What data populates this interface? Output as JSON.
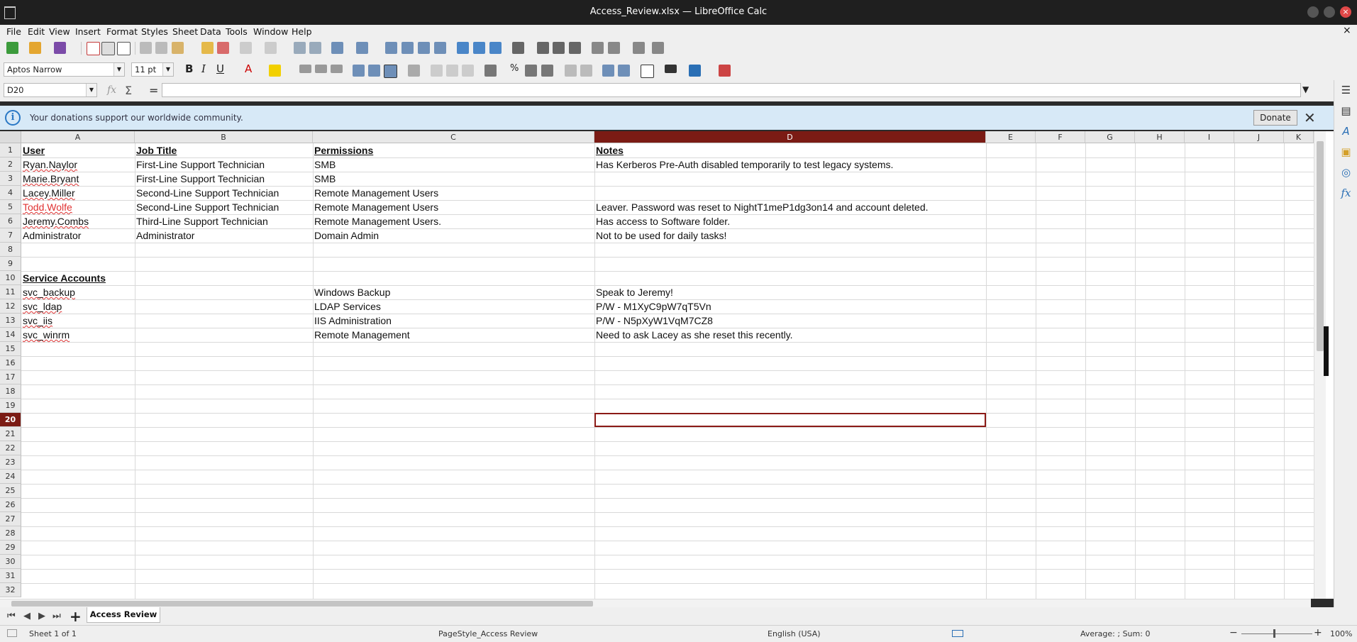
{
  "window": {
    "title": "Access_Review.xlsx — LibreOffice Calc",
    "close_glyph": "×"
  },
  "menu": [
    "File",
    "Edit",
    "View",
    "Insert",
    "Format",
    "Styles",
    "Sheet",
    "Data",
    "Tools",
    "Window",
    "Help"
  ],
  "menu_close_glyph": "×",
  "format": {
    "font_name": "Aptos Narrow",
    "font_size": "11 pt"
  },
  "formula": {
    "name_box": "D20",
    "fx_glyph": "fx",
    "sum_glyph": "Σ",
    "equals_glyph": "=",
    "content": ""
  },
  "infobar": {
    "icon_glyph": "i",
    "message": "Your donations support our worldwide community.",
    "donate_label": "Donate",
    "close_glyph": "✕"
  },
  "sheet": {
    "columns": [
      "A",
      "B",
      "C",
      "D",
      "E",
      "F",
      "G",
      "H",
      "I",
      "J",
      "K"
    ],
    "selected_column": "D",
    "selected_row": "20",
    "rows": [
      "1",
      "2",
      "3",
      "4",
      "5",
      "6",
      "7",
      "8",
      "9",
      "10",
      "11",
      "12",
      "13",
      "14",
      "15",
      "16",
      "17",
      "18",
      "19",
      "20",
      "21",
      "22",
      "23",
      "24",
      "25",
      "26",
      "27",
      "28",
      "29",
      "30",
      "31",
      "32"
    ],
    "cells": {
      "A1": "User",
      "B1": "Job Title",
      "C1": "Permissions",
      "D1": "Notes",
      "A2": "Ryan.Naylor",
      "B2": "First-Line Support Technician",
      "C2": "SMB",
      "D2": "Has Kerberos Pre-Auth disabled temporarily to test legacy systems.",
      "A3": "Marie.Bryant",
      "B3": "First-Line Support Technician",
      "C3": "SMB",
      "A4": "Lacey.Miller",
      "B4": "Second-Line Support Technician",
      "C4": "Remote Management Users",
      "A5": "Todd.Wolfe",
      "B5": "Second-Line Support Technician",
      "C5": "Remote Management Users",
      "D5": "Leaver. Password was reset to NightT1meP1dg3on14 and account deleted.",
      "A6": "Jeremy.Combs",
      "B6": "Third-Line Support Technician",
      "C6": "Remote Management Users.",
      "D6": "Has access to Software folder.",
      "A7": "Administrator",
      "B7": "Administrator",
      "C7": "Domain Admin",
      "D7": "Not to be used for daily tasks!",
      "A10": "Service Accounts",
      "A11": "svc_backup",
      "C11": "Windows Backup",
      "D11": "Speak to Jeremy!",
      "A12": "svc_ldap",
      "C12": "LDAP Services",
      "D12": "P/W - M1XyC9pW7qT5Vn",
      "A13": "svc_iis",
      "C13": "IIS Administration",
      "D13": "P/W - N5pXyW1VqM7CZ8",
      "A14": "svc_winrm",
      "C14": "Remote Management",
      "D14": "Need to ask Lacey as she reset this recently."
    }
  },
  "tabs": {
    "active": "Access Review",
    "add_glyph": "+",
    "nav": [
      "⏮",
      "◀",
      "▶",
      "⏭"
    ]
  },
  "status": {
    "sheet": "Sheet 1 of 1",
    "page_style": "PageStyle_Access Review",
    "language": "English (USA)",
    "summary": "Average: ; Sum: 0",
    "zoom": "100%",
    "zoom_minus": "−",
    "zoom_plus": "+"
  },
  "sidebar_icons": [
    "☰",
    "A",
    "▤",
    "◎",
    "fx"
  ]
}
